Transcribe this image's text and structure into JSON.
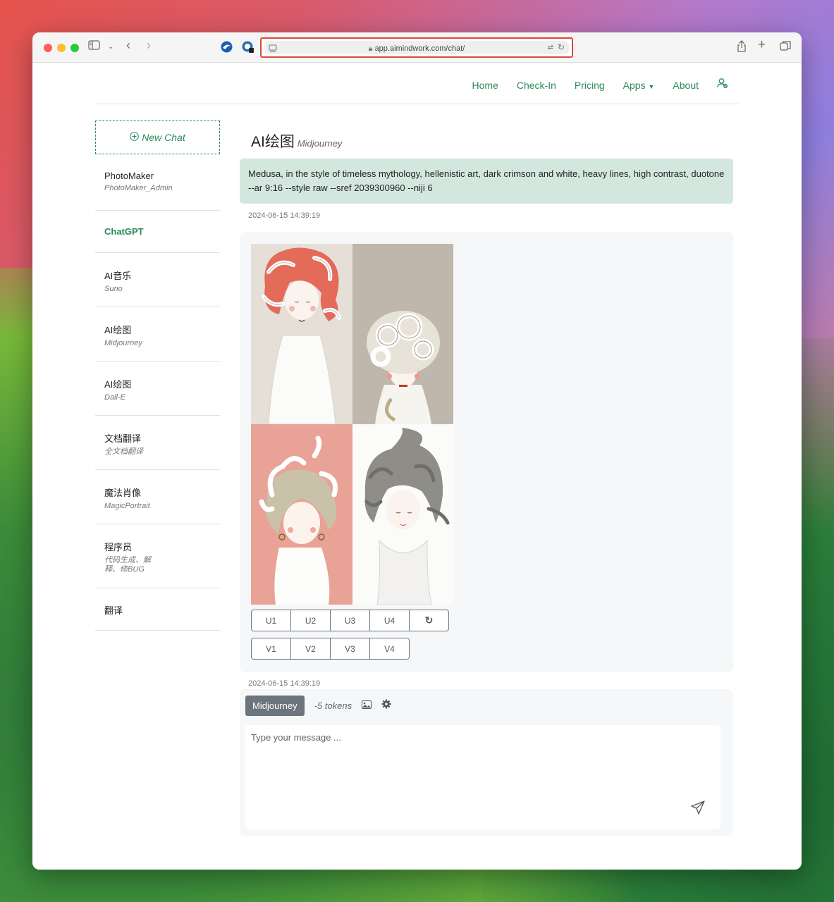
{
  "browser": {
    "url": "app.aimindwork.com/chat/"
  },
  "nav": {
    "items": [
      "Home",
      "Check-In",
      "Pricing",
      "Apps",
      "About"
    ]
  },
  "sidebar": {
    "new_chat": "New Chat",
    "items": [
      {
        "title": "PhotoMaker",
        "sub": "PhotoMaker_Admin"
      },
      {
        "title": "ChatGPT",
        "sub": ""
      },
      {
        "title": "AI音乐",
        "sub": "Suno"
      },
      {
        "title": "AI绘图",
        "sub": "Midjourney"
      },
      {
        "title": "AI绘图",
        "sub": "Dall-E"
      },
      {
        "title": "文档翻译",
        "sub": "全文档翻译"
      },
      {
        "title": "魔法肖像",
        "sub": "MagicPortrait"
      },
      {
        "title": "程序员",
        "sub": "代码生成、解释、修BUG"
      },
      {
        "title": "翻译",
        "sub": ""
      }
    ],
    "active_index": 1
  },
  "main": {
    "title": "AI绘图",
    "subtitle": "Midjourney",
    "prompt": "Medusa, in the style of timeless mythology, hellenistic art, dark crimson and white, heavy lines, high contrast, duotone --ar 9:16 --style raw --sref 2039300960 --niji 6",
    "prompt_time": "2024-06-15 14:39:19",
    "response_time": "2024-06-15 14:39:19",
    "upscale_buttons": [
      "U1",
      "U2",
      "U3",
      "U4"
    ],
    "variation_buttons": [
      "V1",
      "V2",
      "V3",
      "V4"
    ]
  },
  "composer": {
    "model": "Midjourney",
    "tokens": "-5 tokens",
    "placeholder": "Type your message ..."
  },
  "colors": {
    "accent": "#2a8a5c",
    "prompt_bg": "#d4e7df",
    "button_gray": "#6c757d"
  }
}
